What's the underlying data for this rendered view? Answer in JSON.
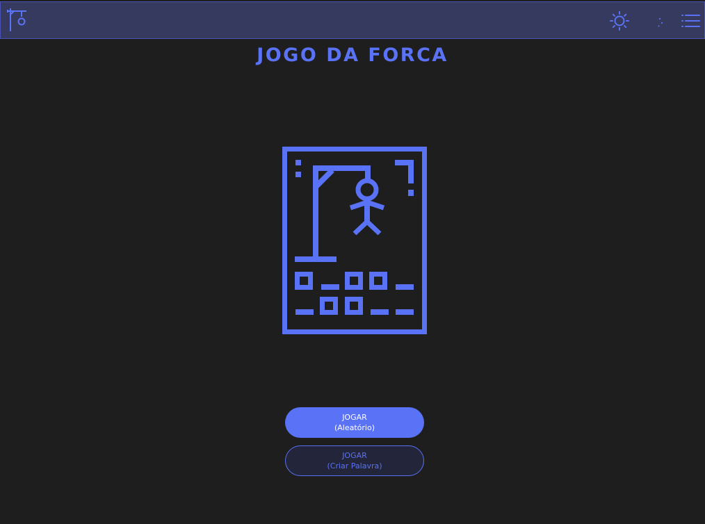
{
  "navbar": {
    "logo_icon": "gallows-logo-icon",
    "icons": [
      "sun-icon",
      "moon-icon",
      "menu-icon"
    ]
  },
  "title": "JOGO DA FORCA",
  "illustration_icon": "hangman-card-icon",
  "buttons": {
    "random": {
      "line1": "JOGAR",
      "line2": "(Aleatório)"
    },
    "create": {
      "line1": "JOGAR",
      "line2": "(Criar Palavra)"
    }
  },
  "colors": {
    "accent": "#5a72f5",
    "background": "#1e1e1e",
    "navbar": "#363a5e",
    "secondary_button_bg": "#23253a"
  }
}
